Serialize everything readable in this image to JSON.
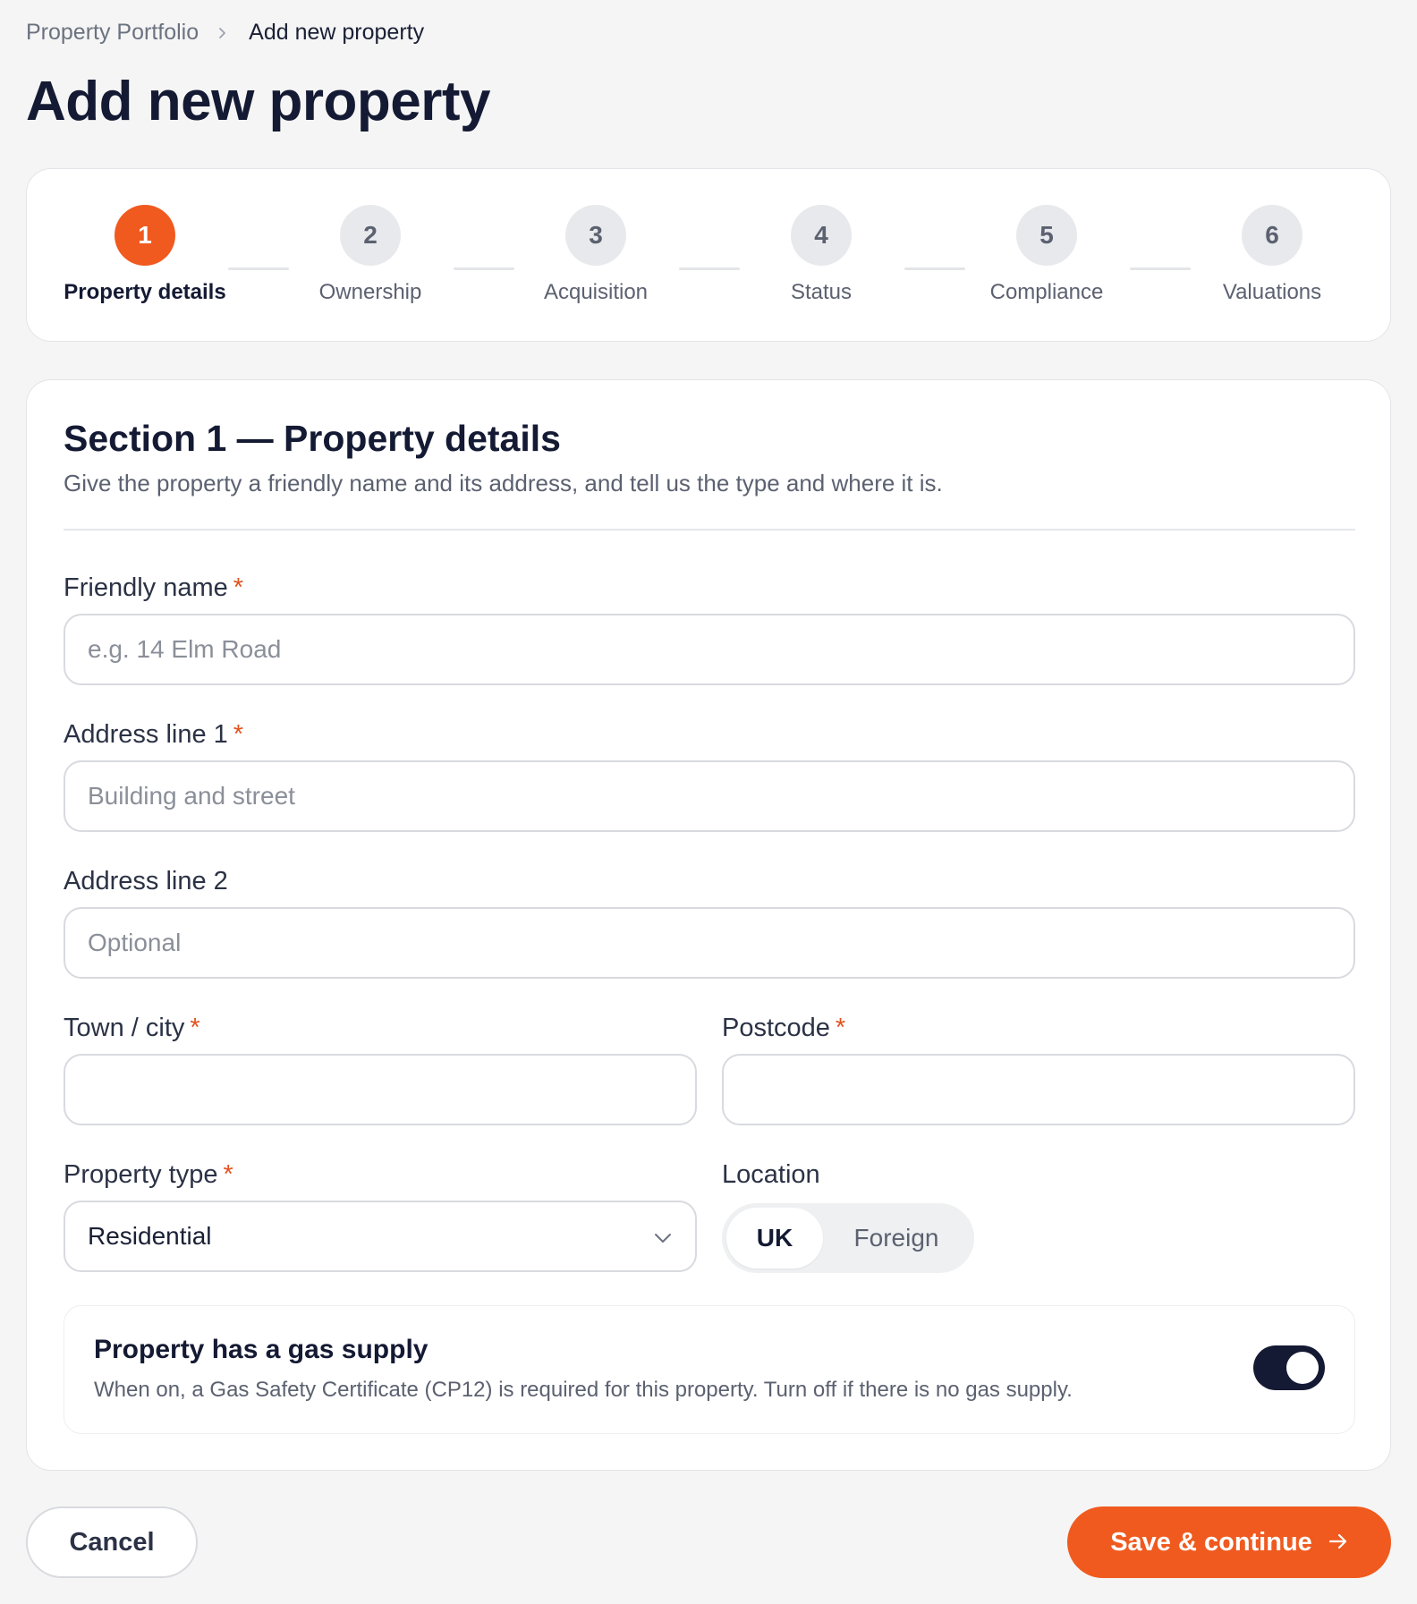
{
  "breadcrumb": {
    "parent": "Property Portfolio",
    "current": "Add new property"
  },
  "page_title": "Add new property",
  "steps": [
    {
      "number": "1",
      "label": "Property details",
      "active": true
    },
    {
      "number": "2",
      "label": "Ownership",
      "active": false
    },
    {
      "number": "3",
      "label": "Acquisition",
      "active": false
    },
    {
      "number": "4",
      "label": "Status",
      "active": false
    },
    {
      "number": "5",
      "label": "Compliance",
      "active": false
    },
    {
      "number": "6",
      "label": "Valuations",
      "active": false
    }
  ],
  "section": {
    "title": "Section 1 — Property details",
    "description": "Give the property a friendly name and its address, and tell us the type and where it is."
  },
  "fields": {
    "friendly_name": {
      "label": "Friendly name",
      "required_mark": "*",
      "placeholder": "e.g. 14 Elm Road",
      "value": ""
    },
    "address1": {
      "label": "Address line 1",
      "required_mark": "*",
      "placeholder": "Building and street",
      "value": ""
    },
    "address2": {
      "label": "Address line 2",
      "placeholder": "Optional",
      "value": ""
    },
    "town": {
      "label": "Town / city",
      "required_mark": "*",
      "placeholder": "",
      "value": ""
    },
    "postcode": {
      "label": "Postcode",
      "required_mark": "*",
      "placeholder": "",
      "value": ""
    },
    "property_type": {
      "label": "Property type",
      "required_mark": "*",
      "value": "Residential"
    },
    "location": {
      "label": "Location",
      "options": [
        "UK",
        "Foreign"
      ],
      "selected": "UK"
    }
  },
  "gas_supply": {
    "title": "Property has a gas supply",
    "description": "When on, a Gas Safety Certificate (CP12) is required for this property. Turn off if there is no gas supply.",
    "enabled": true
  },
  "actions": {
    "cancel": "Cancel",
    "save": "Save & continue"
  },
  "icons": {
    "breadcrumb_separator": "chevron-right-icon",
    "select_caret": "chevron-down-icon",
    "save_arrow": "arrow-right-icon"
  },
  "colors": {
    "accent": "#f05a1f",
    "primary_dark": "#141a33",
    "required": "#e2521e",
    "background": "#f5f5f5"
  }
}
